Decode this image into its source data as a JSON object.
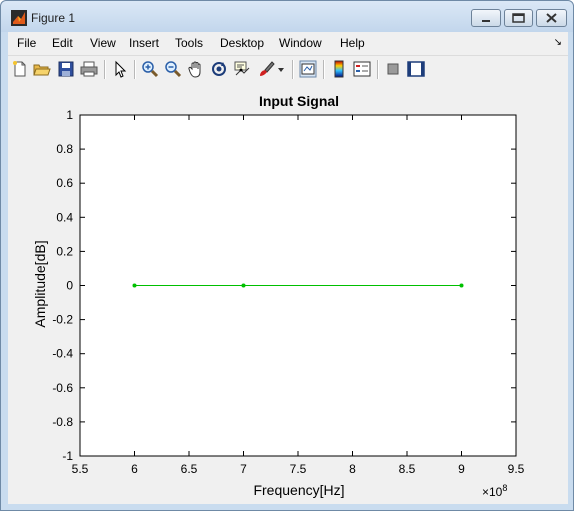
{
  "window": {
    "title": "Figure 1"
  },
  "menu": [
    "File",
    "Edit",
    "View",
    "Insert",
    "Tools",
    "Desktop",
    "Window",
    "Help"
  ],
  "toolbar_icons": [
    "new-figure-icon",
    "open-file-icon",
    "save-icon",
    "print-icon",
    "pointer-icon",
    "zoom-in-icon",
    "zoom-out-icon",
    "pan-icon",
    "rotate-3d-icon",
    "data-cursor-icon",
    "brush-icon",
    "link-plot-icon",
    "colorbar-icon",
    "legend-icon",
    "hide-plot-tools-icon",
    "show-plot-tools-icon"
  ],
  "chart_data": {
    "type": "line",
    "title": "Input Signal",
    "xlabel": "Frequency[Hz]",
    "ylabel": "Amplitude[dB]",
    "x_exponent_label": "×10",
    "x_exponent_power": "8",
    "xlim": [
      5.5,
      9.5
    ],
    "ylim": [
      -1,
      1
    ],
    "xticks": [
      "5.5",
      "6",
      "6.5",
      "7",
      "7.5",
      "8",
      "8.5",
      "9",
      "9.5"
    ],
    "yticks": [
      "1",
      "0.8",
      "0.6",
      "0.4",
      "0.2",
      "0",
      "-0.2",
      "-0.4",
      "-0.6",
      "-0.8",
      "-1"
    ],
    "series": [
      {
        "x": [
          6,
          7,
          9
        ],
        "y": [
          0,
          0,
          0
        ],
        "color": "#00c000",
        "marker": "dot"
      }
    ],
    "grid": false
  }
}
